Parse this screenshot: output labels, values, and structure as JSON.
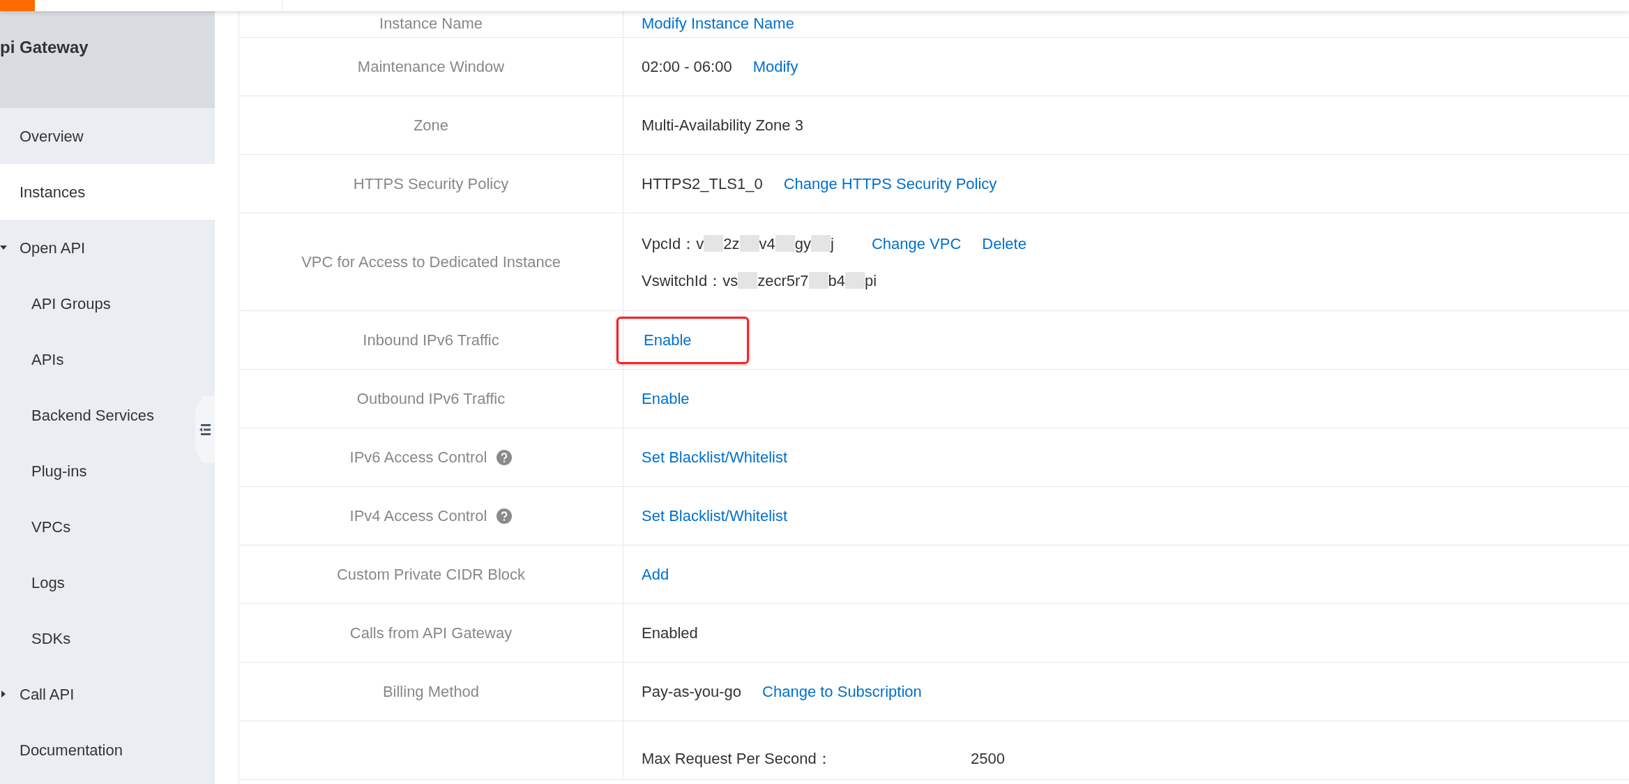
{
  "sidebar": {
    "title": "pi Gateway",
    "items": [
      {
        "label": "Overview",
        "selected": false
      },
      {
        "label": "Instances",
        "selected": true
      },
      {
        "label": "Open API",
        "selected": false,
        "expanded": true,
        "children": [
          {
            "label": "API Groups",
            "selected": false
          },
          {
            "label": "APIs",
            "selected": false
          },
          {
            "label": "Backend Services",
            "selected": false
          },
          {
            "label": "Plug-ins",
            "selected": false
          },
          {
            "label": "VPCs",
            "selected": false
          },
          {
            "label": "Logs",
            "selected": false
          },
          {
            "label": "SDKs",
            "selected": false
          }
        ]
      },
      {
        "label": "Call API",
        "selected": false,
        "expanded": false
      },
      {
        "label": "Documentation",
        "selected": false
      }
    ]
  },
  "details": {
    "rows": [
      {
        "label": "Instance Name",
        "help": false,
        "highlighted": false,
        "lines": [
          [
            {
              "kind": "link",
              "text": "Modify Instance Name"
            }
          ]
        ]
      },
      {
        "label": "Maintenance Window",
        "help": false,
        "highlighted": false,
        "lines": [
          [
            {
              "kind": "text",
              "text": "02:00 - 06:00"
            },
            {
              "kind": "link",
              "text": "Modify"
            }
          ]
        ]
      },
      {
        "label": "Zone",
        "help": false,
        "highlighted": false,
        "lines": [
          [
            {
              "kind": "text",
              "text": "Multi-Availability Zone 3"
            }
          ]
        ]
      },
      {
        "label": "HTTPS Security Policy",
        "help": false,
        "highlighted": false,
        "lines": [
          [
            {
              "kind": "text",
              "text": "HTTPS2_TLS1_0"
            },
            {
              "kind": "link",
              "text": "Change HTTPS Security Policy"
            }
          ]
        ]
      },
      {
        "label": "VPC for Access to Dedicated Instance",
        "help": false,
        "highlighted": false,
        "lines": [
          [
            {
              "kind": "id",
              "label": "VpcId：",
              "segments": [
                {
                  "kind": "text",
                  "text": "v"
                },
                {
                  "kind": "mask"
                },
                {
                  "kind": "text",
                  "text": "2z"
                },
                {
                  "kind": "mask"
                },
                {
                  "kind": "text",
                  "text": "v4"
                },
                {
                  "kind": "mask"
                },
                {
                  "kind": "text",
                  "text": "gy"
                },
                {
                  "kind": "mask"
                },
                {
                  "kind": "text",
                  "text": "j"
                }
              ]
            },
            {
              "kind": "link",
              "text": "Change VPC"
            },
            {
              "kind": "link",
              "text": "Delete"
            }
          ],
          [
            {
              "kind": "id",
              "label": "VswitchId：",
              "segments": [
                {
                  "kind": "text",
                  "text": "vs"
                },
                {
                  "kind": "mask"
                },
                {
                  "kind": "text",
                  "text": "zecr5r7"
                },
                {
                  "kind": "mask"
                },
                {
                  "kind": "text",
                  "text": "b4"
                },
                {
                  "kind": "mask"
                },
                {
                  "kind": "text",
                  "text": "pi"
                }
              ]
            }
          ]
        ]
      },
      {
        "label": "Inbound IPv6 Traffic",
        "help": false,
        "highlighted": true,
        "lines": [
          [
            {
              "kind": "link",
              "text": "Enable"
            }
          ]
        ]
      },
      {
        "label": "Outbound IPv6 Traffic",
        "help": false,
        "highlighted": false,
        "lines": [
          [
            {
              "kind": "link",
              "text": "Enable"
            }
          ]
        ]
      },
      {
        "label": "IPv6 Access Control",
        "help": true,
        "highlighted": false,
        "lines": [
          [
            {
              "kind": "link",
              "text": "Set Blacklist/Whitelist"
            }
          ]
        ]
      },
      {
        "label": "IPv4 Access Control",
        "help": true,
        "highlighted": false,
        "lines": [
          [
            {
              "kind": "link",
              "text": "Set Blacklist/Whitelist"
            }
          ]
        ]
      },
      {
        "label": "Custom Private CIDR Block",
        "help": false,
        "highlighted": false,
        "lines": [
          [
            {
              "kind": "link",
              "text": "Add"
            }
          ]
        ]
      },
      {
        "label": "Calls from API Gateway",
        "help": false,
        "highlighted": false,
        "lines": [
          [
            {
              "kind": "text",
              "text": "Enabled"
            }
          ]
        ]
      },
      {
        "label": "Billing Method",
        "help": false,
        "highlighted": false,
        "lines": [
          [
            {
              "kind": "text",
              "text": "Pay-as-you-go"
            },
            {
              "kind": "link",
              "text": "Change to Subscription"
            }
          ]
        ]
      },
      {
        "label": "",
        "help": false,
        "highlighted": false,
        "lines": [
          [
            {
              "kind": "field",
              "name": "Max Request Per Second：",
              "value": "2500"
            }
          ]
        ]
      }
    ]
  }
}
